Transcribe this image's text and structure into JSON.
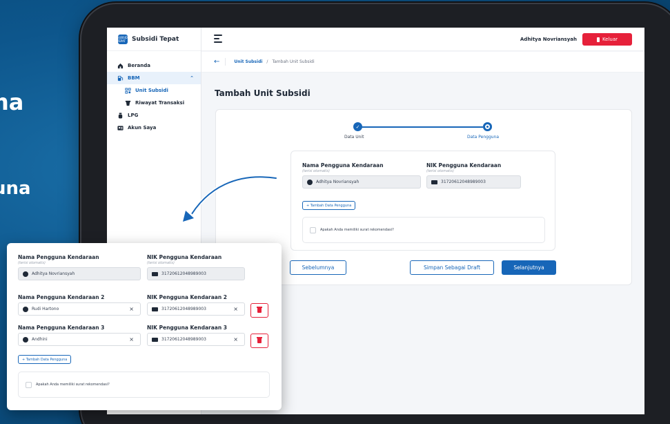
{
  "background": {
    "text_top": "na",
    "text_bottom": "una"
  },
  "app": {
    "name": "Subsidi Tepat",
    "logo_text": "SUBSIDI TEPAT"
  },
  "sidebar": {
    "items": [
      {
        "label": "Beranda",
        "icon": "home-icon"
      },
      {
        "label": "BBM",
        "icon": "fuel-pump-icon",
        "expanded": true
      },
      {
        "label": "Unit Subsidi",
        "icon": "qr-icon"
      },
      {
        "label": "Riwayat Transaksi",
        "icon": "receipt-icon"
      },
      {
        "label": "LPG",
        "icon": "gas-cylinder-icon"
      },
      {
        "label": "Akun Saya",
        "icon": "id-card-icon"
      }
    ]
  },
  "topbar": {
    "user_name": "Adhitya Novriansyah",
    "logout_label": "Keluar"
  },
  "breadcrumb": {
    "parent": "Unit Subsidi",
    "separator": "/",
    "current": "Tambah Unit Subsidi"
  },
  "page": {
    "title": "Tambah Unit Subsidi"
  },
  "stepper": {
    "steps": [
      "Data Unit",
      "Data Pengguna"
    ],
    "active_step": 2
  },
  "form": {
    "name_label": "Nama Pengguna Kendaraan",
    "name_hint": "(terisi otomatis)",
    "name_value": "Adhitya Novriansyah",
    "nik_label": "NIK Pengguna Kendaraan",
    "nik_hint": "(terisi otomatis)",
    "nik_value": "31720612048989003",
    "add_user_label": "+ Tambah Data Pengguna",
    "recommendation_label": "Apakah Anda memiliki surat rekomendasi?"
  },
  "actions": {
    "prev": "Sebelumnya",
    "draft": "Simpan Sebagai Draft",
    "next": "Selanjutnya"
  },
  "overlay": {
    "rows": [
      {
        "name_label": "Nama Pengguna Kendaraan",
        "name_hint": "(terisi otomatis)",
        "name_value": "Adhitya Novriansyah",
        "nik_label": "NIK Pengguna Kendaraan",
        "nik_hint": "(terisi otomatis)",
        "nik_value": "31720612048989003"
      },
      {
        "name_label": "Nama Pengguna Kendaraan 2",
        "name_value": "Rudi Hartono",
        "nik_label": "NIK Pengguna Kendaraan 2",
        "nik_value": "31720612048989003"
      },
      {
        "name_label": "Nama Pengguna Kendaraan 3",
        "name_value": "Andhini",
        "nik_label": "NIK Pengguna Kendaraan 3",
        "nik_value": "31720612048989003"
      }
    ],
    "add_user_label": "+ Tambah Data Pengguna",
    "recommendation_label": "Apakah Anda memiliki surat rekomendasi?"
  },
  "colors": {
    "primary": "#1766b8",
    "danger": "#e6213a",
    "background": "#0d568c"
  }
}
